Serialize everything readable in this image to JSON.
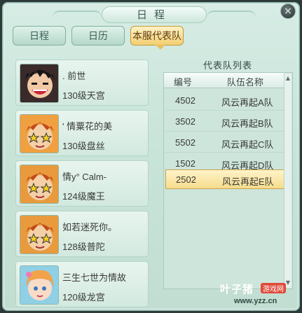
{
  "window": {
    "title": "日程",
    "close_icon": "×"
  },
  "tabs": [
    {
      "label": "日程",
      "active": false
    },
    {
      "label": "日历",
      "active": false
    },
    {
      "label": "本服代表队",
      "active": true
    }
  ],
  "members": [
    {
      "name": ". 前世",
      "level": "130级天宫"
    },
    {
      "name": "' 情粟花的美",
      "level": "130级盘丝"
    },
    {
      "name": "情y° Calm-",
      "level": "124级魔王"
    },
    {
      "name": "如若迷死你。",
      "level": "128级普陀"
    },
    {
      "name": "三生七世为情故",
      "level": "120级龙宫"
    }
  ],
  "team_list": {
    "title": "代表队列表",
    "columns": [
      "编号",
      "队伍名称"
    ],
    "rows": [
      {
        "code": "4502",
        "name": "风云再起A队",
        "selected": false
      },
      {
        "code": "3502",
        "name": "风云再起B队",
        "selected": false
      },
      {
        "code": "5502",
        "name": "风云再起C队",
        "selected": false
      },
      {
        "code": "1502",
        "name": "风云再起D队",
        "selected": false
      },
      {
        "code": "2502",
        "name": "风云再起E队",
        "selected": true
      }
    ],
    "scroll_up_icon": "▲",
    "scroll_down_icon": "▼"
  },
  "watermark": {
    "brand": "叶子猪",
    "tag": "游戏网",
    "url": "www.yzz.cn"
  },
  "colors": {
    "panel_bg": "#cfe7dd",
    "active_tab": "#f3cf72",
    "selected_row": "#f6dc8c"
  }
}
